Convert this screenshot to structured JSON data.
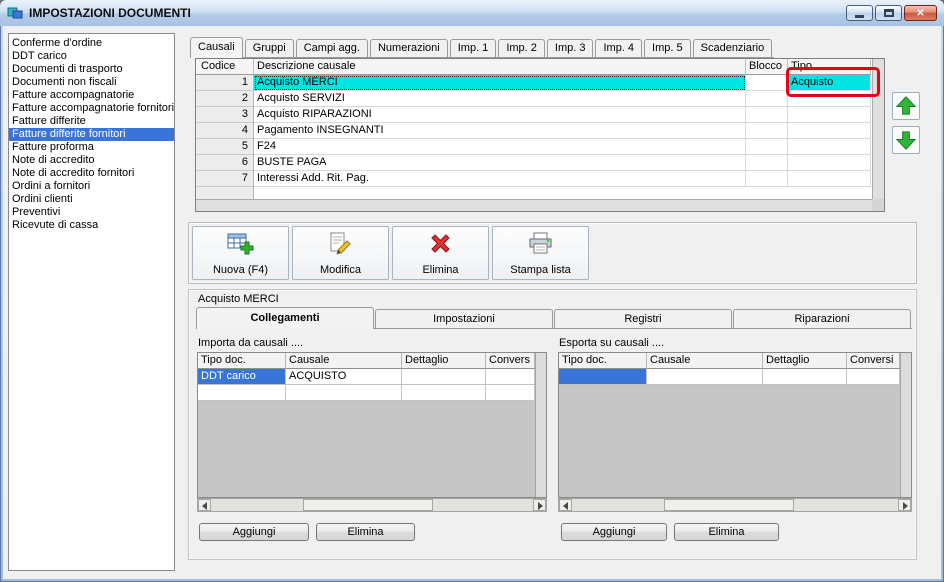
{
  "window": {
    "title": "IMPOSTAZIONI DOCUMENTI"
  },
  "sidebar": {
    "items": [
      {
        "label": "Conferme d'ordine",
        "selected": false
      },
      {
        "label": "DDT carico",
        "selected": false
      },
      {
        "label": "Documenti di trasporto",
        "selected": false
      },
      {
        "label": "Documenti non fiscali",
        "selected": false
      },
      {
        "label": "Fatture accompagnatorie",
        "selected": false
      },
      {
        "label": "Fatture accompagnatorie fornitori",
        "selected": false
      },
      {
        "label": "Fatture differite",
        "selected": false
      },
      {
        "label": "Fatture differite fornitori",
        "selected": true
      },
      {
        "label": "Fatture proforma",
        "selected": false
      },
      {
        "label": "Note di accredito",
        "selected": false
      },
      {
        "label": "Note di accredito fornitori",
        "selected": false
      },
      {
        "label": "Ordini a fornitori",
        "selected": false
      },
      {
        "label": "Ordini clienti",
        "selected": false
      },
      {
        "label": "Preventivi",
        "selected": false
      },
      {
        "label": "Ricevute di cassa",
        "selected": false
      }
    ]
  },
  "tabs": [
    {
      "label": "Causali",
      "active": true
    },
    {
      "label": "Gruppi",
      "active": false
    },
    {
      "label": "Campi agg.",
      "active": false
    },
    {
      "label": "Numerazioni",
      "active": false
    },
    {
      "label": "Imp. 1",
      "active": false
    },
    {
      "label": "Imp. 2",
      "active": false
    },
    {
      "label": "Imp. 3",
      "active": false
    },
    {
      "label": "Imp. 4",
      "active": false
    },
    {
      "label": "Imp. 5",
      "active": false
    },
    {
      "label": "Scadenziario",
      "active": false
    }
  ],
  "grid": {
    "columns": [
      "Codice",
      "Descrizione causale",
      "Blocco",
      "Tipo"
    ],
    "rows": [
      {
        "codice": "1",
        "descrizione": "Acquisto MERCI",
        "blocco": "",
        "tipo": "Acquisto",
        "selected": true
      },
      {
        "codice": "2",
        "descrizione": "Acquisto SERVIZI",
        "blocco": "",
        "tipo": ""
      },
      {
        "codice": "3",
        "descrizione": "Acquisto RIPARAZIONI",
        "blocco": "",
        "tipo": ""
      },
      {
        "codice": "4",
        "descrizione": "Pagamento INSEGNANTI",
        "blocco": "",
        "tipo": ""
      },
      {
        "codice": "5",
        "descrizione": "F24",
        "blocco": "",
        "tipo": ""
      },
      {
        "codice": "6",
        "descrizione": "BUSTE PAGA",
        "blocco": "",
        "tipo": ""
      },
      {
        "codice": "7",
        "descrizione": "Interessi Add. Rit. Pag.",
        "blocco": "",
        "tipo": ""
      }
    ]
  },
  "toolbar": {
    "buttons": [
      {
        "label": "Nuova (F4)",
        "icon": "new-record-icon"
      },
      {
        "label": "Modifica",
        "icon": "edit-icon"
      },
      {
        "label": "Elimina",
        "icon": "delete-x-icon"
      },
      {
        "label": "Stampa lista",
        "icon": "printer-icon"
      }
    ]
  },
  "detail": {
    "title": "Acquisto MERCI",
    "tabs": [
      {
        "label": "Collegamenti",
        "active": true
      },
      {
        "label": "Impostazioni",
        "active": false
      },
      {
        "label": "Registri",
        "active": false
      },
      {
        "label": "Riparazioni",
        "active": false
      }
    ],
    "import_panel": {
      "label": "Importa da causali ....",
      "columns": [
        "Tipo doc.",
        "Causale",
        "Dettaglio",
        "Convers"
      ],
      "rows": [
        {
          "tipo_doc": "DDT carico",
          "causale": "ACQUISTO",
          "dettaglio": "",
          "conversione": ""
        }
      ],
      "buttons": {
        "add": "Aggiungi",
        "delete": "Elimina"
      }
    },
    "export_panel": {
      "label": "Esporta su causali ....",
      "columns": [
        "Tipo doc.",
        "Causale",
        "Dettaglio",
        "Conversi"
      ],
      "rows": [
        {
          "tipo_doc": "",
          "causale": "",
          "dettaglio": "",
          "conversione": ""
        }
      ],
      "buttons": {
        "add": "Aggiungi",
        "delete": "Elimina"
      }
    }
  },
  "colors": {
    "selection_cyan": "#00e4e4",
    "selection_blue": "#3875d7",
    "annotation_red": "#e30613",
    "arrow_green": "#2fb53a",
    "titlebar_blue": "#b4cce8"
  }
}
